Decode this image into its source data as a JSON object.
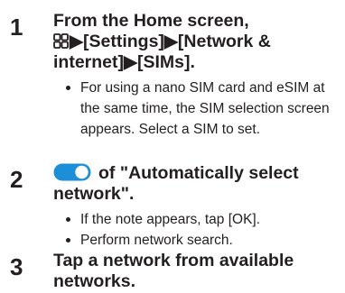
{
  "steps": [
    {
      "number": "1",
      "title_line1": "From the Home screen,",
      "title_line2_after_icon": "▶[Settings]▶[Network &",
      "title_line3": "internet]▶[SIMs].",
      "icon": "apps-grid-icon",
      "bullets": [
        "For using a nano SIM card and eSIM at the same time, the SIM selection screen appears. Select a SIM to set."
      ]
    },
    {
      "number": "2",
      "icon": "toggle-switch-icon",
      "title_line1_after_icon": "of \"Automatically select",
      "title_line2": "network\".",
      "bullets": [
        "If the note appears, tap [OK].",
        "Perform network search."
      ]
    },
    {
      "number": "3",
      "title_line1": "Tap a network from available",
      "title_line2": "networks."
    }
  ],
  "colors": {
    "text": "#231f20",
    "toggle_track": "#1d8fd8",
    "toggle_knob": "#ffffff"
  }
}
